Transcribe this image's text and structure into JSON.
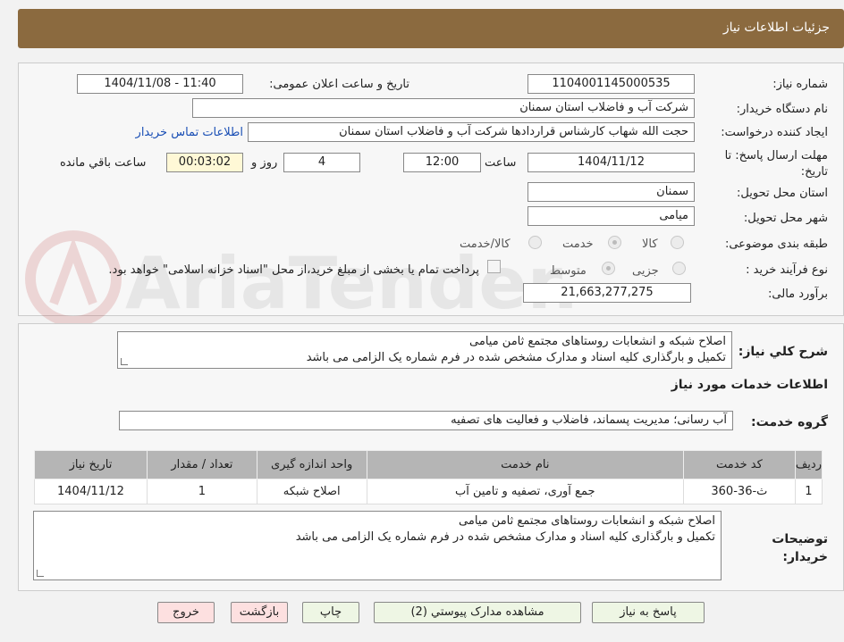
{
  "header": {
    "title": "جزئیات اطلاعات نیاز"
  },
  "form": {
    "need_number": {
      "label": "شماره نیاز:",
      "value": "1104001145000535"
    },
    "announce_datetime": {
      "label": "تاریخ و ساعت اعلان عمومی:",
      "value": "1404/11/08 - 11:40"
    },
    "buyer_org": {
      "label": "نام دستگاه خریدار:",
      "value": "شرکت آب و فاضلاب استان سمنان"
    },
    "requester": {
      "label": "ایجاد کننده درخواست:",
      "value": "حجت الله شهاب کارشناس قراردادها شرکت آب و فاضلاب استان سمنان",
      "contact_link": "اطلاعات تماس خریدار"
    },
    "deadline": {
      "label": "مهلت ارسال پاسخ: تا تاریخ:",
      "date": "1404/11/12",
      "time_label": "ساعت",
      "time": "12:00",
      "days": "4",
      "days_label": "روز و",
      "remaining": "00:03:02",
      "remaining_label": "ساعت باقي مانده"
    },
    "delivery_province": {
      "label": "استان محل تحویل:",
      "value": "سمنان"
    },
    "delivery_city": {
      "label": "شهر محل تحویل:",
      "value": "میامی"
    },
    "category": {
      "label": "طبقه بندی موضوعی:",
      "options": [
        "کالا",
        "خدمت",
        "کالا/خدمت"
      ],
      "selected": "خدمت"
    },
    "purchase_process": {
      "label": "نوع فرآیند خرید :",
      "options": [
        "جزیی",
        "متوسط"
      ],
      "selected": "متوسط",
      "note": "پرداخت تمام یا بخشی از مبلغ خرید،از محل \"اسناد خزانه اسلامی\" خواهد بود."
    },
    "budget": {
      "label": "برآورد مالی:",
      "value": "21,663,277,275"
    }
  },
  "summary": {
    "label": "شرح کلي نياز:",
    "lines": [
      "اصلاح شبکه و انشعابات روستاهای مجتمع ثامن میامی",
      "تکمیل و بارگذاری کلیه اسناد و مدارک مشخص شده در فرم شماره یک  الزامی می باشد"
    ]
  },
  "services_section": {
    "title": "اطلاعات خدمات مورد نیاز",
    "group_label": "گروه خدمت:",
    "group_value": "آب رسانی؛ مدیریت پسماند، فاضلاب و فعالیت های تصفیه"
  },
  "table": {
    "headers": [
      "ردیف",
      "کد خدمت",
      "نام خدمت",
      "واحد اندازه گیری",
      "تعداد / مقدار",
      "تاریخ نیاز"
    ],
    "rows": [
      [
        "1",
        "ث-36-360",
        "جمع آوری، تصفیه و تامین آب",
        "اصلاح شبکه",
        "1",
        "1404/11/12"
      ]
    ]
  },
  "buyer_notes": {
    "label": "توضیحات خریدار:",
    "lines": [
      "اصلاح شبکه و انشعابات روستاهای مجتمع ثامن میامی",
      "تکمیل و بارگذاری کلیه اسناد و مدارک مشخص شده در فرم شماره یک  الزامی می باشد"
    ]
  },
  "buttons": {
    "reply": "پاسخ به نیاز",
    "attachments": "مشاهده مدارک پیوستي (2)",
    "print": "چاپ",
    "back": "بازگشت",
    "exit": "خروج"
  },
  "watermark": {
    "text": "AriaTender.net"
  },
  "colors": {
    "header_bg": "#8b6a3f",
    "link": "#1a4fb5",
    "table_header": "#b5b5b5",
    "button_green": "#eef6e4",
    "button_pink": "#fde0e0"
  }
}
